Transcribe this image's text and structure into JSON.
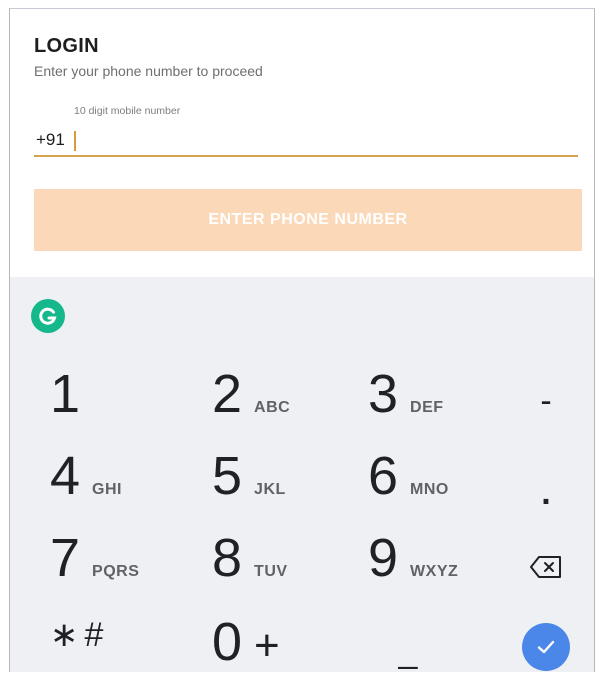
{
  "login": {
    "title": "LOGIN",
    "subtitle": "Enter your phone number to proceed",
    "field_label": "10 digit mobile number",
    "prefix": "+91",
    "value": "",
    "button_label": "ENTER PHONE NUMBER"
  },
  "keyboard": {
    "keys": [
      {
        "digit": "1",
        "letters": ""
      },
      {
        "digit": "2",
        "letters": "ABC"
      },
      {
        "digit": "3",
        "letters": "DEF"
      },
      {
        "digit": "4",
        "letters": "GHI"
      },
      {
        "digit": "5",
        "letters": "JKL"
      },
      {
        "digit": "6",
        "letters": "MNO"
      },
      {
        "digit": "7",
        "letters": "PQRS"
      },
      {
        "digit": "8",
        "letters": "TUV"
      },
      {
        "digit": "9",
        "letters": "WXYZ"
      },
      {
        "digit": "0",
        "letters": "+"
      }
    ],
    "symbols": {
      "star_hash": "∗#",
      "dash": "-",
      "dot": ".",
      "space": "_"
    },
    "icons": {
      "grammarly": "grammarly-icon",
      "backspace": "backspace-icon",
      "done": "checkmark-icon"
    },
    "colors": {
      "accent": "#d7a24f",
      "button": "#fbd8b8",
      "done": "#4a87e8",
      "grammarly": "#15b88a"
    }
  }
}
